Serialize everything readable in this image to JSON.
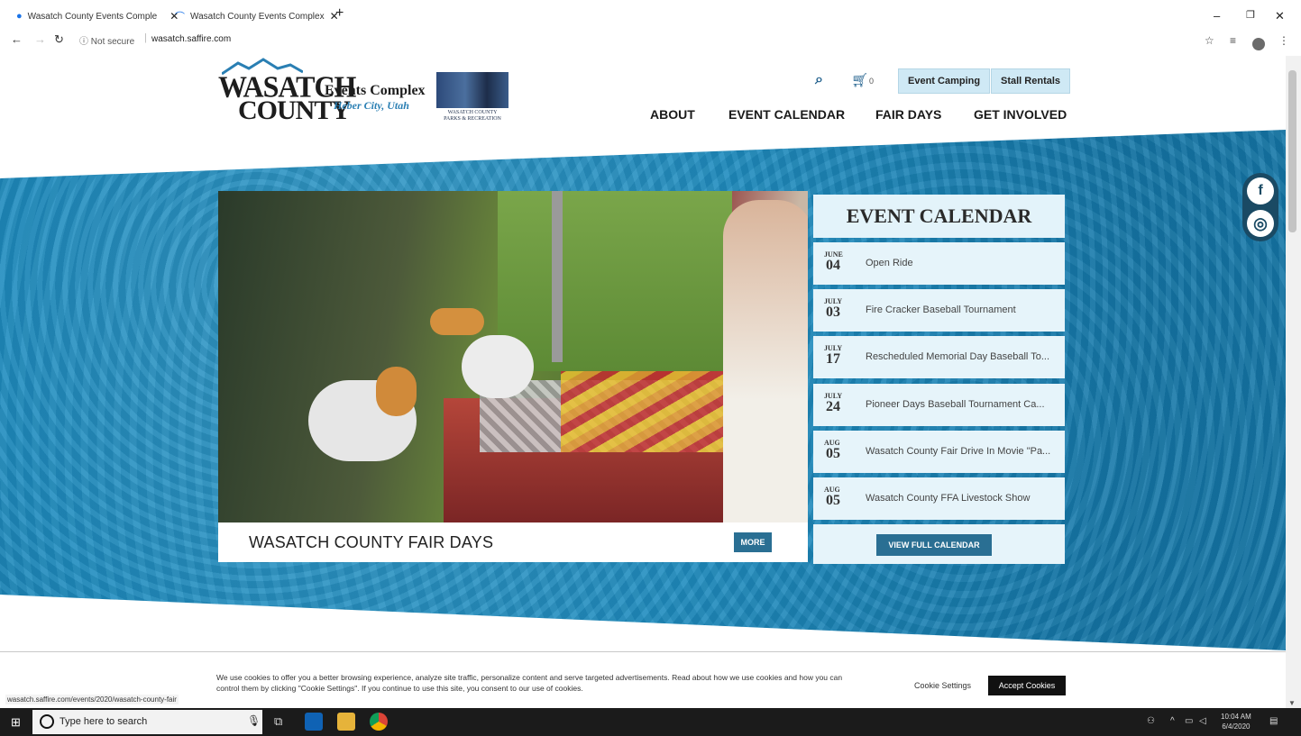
{
  "browser": {
    "tabs": [
      {
        "title": "Wasatch County Events Comple"
      },
      {
        "title": "Wasatch County Events Complex"
      }
    ],
    "new_tab": "+",
    "security": "Not secure",
    "url": "wasatch.saffire.com",
    "status_url": "wasatch.saffire.com/events/2020/wasatch-county-fair"
  },
  "header": {
    "logo": {
      "line1": "WASATCH",
      "line2": "COUNTY",
      "events": "Events Complex",
      "city": "Heber City, Utah"
    },
    "parks_logo": {
      "line1": "WASATCH COUNTY",
      "line2": "PARKS & RECREATION"
    },
    "cart_count": "0",
    "buttons": [
      "Event Camping",
      "Stall Rentals"
    ],
    "nav": [
      "ABOUT",
      "EVENT CALENDAR",
      "FAIR DAYS",
      "GET INVOLVED"
    ]
  },
  "hero": {
    "caption": "WASATCH COUNTY FAIR DAYS",
    "more_label": "MORE"
  },
  "calendar": {
    "title": "EVENT CALENDAR",
    "events": [
      {
        "month": "JUNE",
        "day": "04",
        "name": "Open Ride"
      },
      {
        "month": "JULY",
        "day": "03",
        "name": "Fire Cracker Baseball Tournament"
      },
      {
        "month": "JULY",
        "day": "17",
        "name": "Rescheduled Memorial Day Baseball To..."
      },
      {
        "month": "JULY",
        "day": "24",
        "name": "Pioneer Days Baseball Tournament Ca..."
      },
      {
        "month": "AUG",
        "day": "05",
        "name": "Wasatch County Fair Drive In Movie \"Pa..."
      },
      {
        "month": "AUG",
        "day": "05",
        "name": "Wasatch County FFA Livestock Show"
      }
    ],
    "view_full_label": "VIEW FULL CALENDAR"
  },
  "social": {
    "facebook": "f",
    "instagram": "◎"
  },
  "cookie": {
    "text": "We use cookies to offer you a better browsing experience, analyze site traffic, personalize content and serve targeted advertisements. Read about how we use cookies and how you can control them by clicking \"Cookie Settings\". If you continue to use this site, you consent to our use of cookies.",
    "settings_label": "Cookie Settings",
    "accept_label": "Accept Cookies"
  },
  "taskbar": {
    "search_placeholder": "Type here to search",
    "time": "10:04 AM",
    "date": "6/4/2020"
  }
}
